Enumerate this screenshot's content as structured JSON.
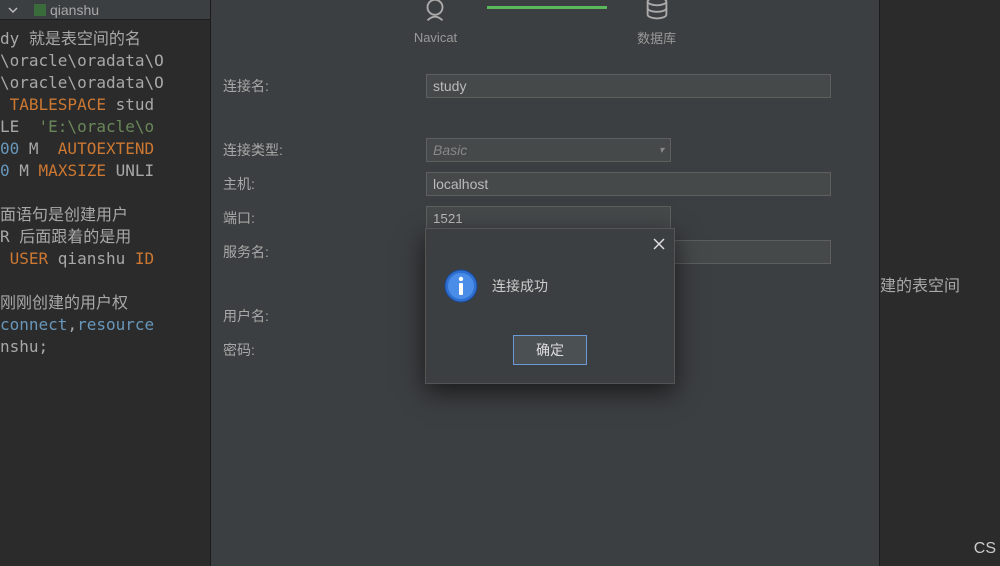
{
  "tab": {
    "name": "qianshu"
  },
  "code": {
    "l1a": "dy ",
    "l1b": "就是表空间的名",
    "l2": "\\oracle\\oradata\\O",
    "l3": "\\oracle\\oradata\\O",
    "l4a": " TABLESPACE ",
    "l4b": "stud",
    "l5a": "LE  ",
    "l5b": "'E:\\oracle\\o",
    "l6a": "00",
    "l6b": " M  ",
    "l6c": "AUTOEXTEND",
    "l7a": "0",
    "l7b": " M ",
    "l7c": "MAXSIZE ",
    "l7d": "UNLI",
    "l8": "面语句是创建用户",
    "l9a": "R ",
    "l9b": "后面跟着的是用",
    "l10a": " USER ",
    "l10b": "qianshu ",
    "l10c": "ID",
    "l11": "刚刚创建的用户权",
    "l12a": "connect",
    "l12b": ",",
    "l12c": "resource",
    "l13a": "nshu",
    "l13b": ";"
  },
  "steps": {
    "navicat": "Navicat",
    "database": "数据库"
  },
  "form": {
    "conn_name_label": "连接名:",
    "conn_name_value": "study",
    "conn_type_label": "连接类型:",
    "conn_type_value": "Basic",
    "host_label": "主机:",
    "host_value": "localhost",
    "port_label": "端口:",
    "port_value": "1521",
    "service_label": "服务名:",
    "service_value": "",
    "user_label": "用户名:",
    "user_value": "",
    "pwd_label": "密码:",
    "pwd_value": ""
  },
  "modal": {
    "message": "连接成功",
    "ok": "确定"
  },
  "right": {
    "snippet": "建的表空间",
    "cs": "CS"
  }
}
